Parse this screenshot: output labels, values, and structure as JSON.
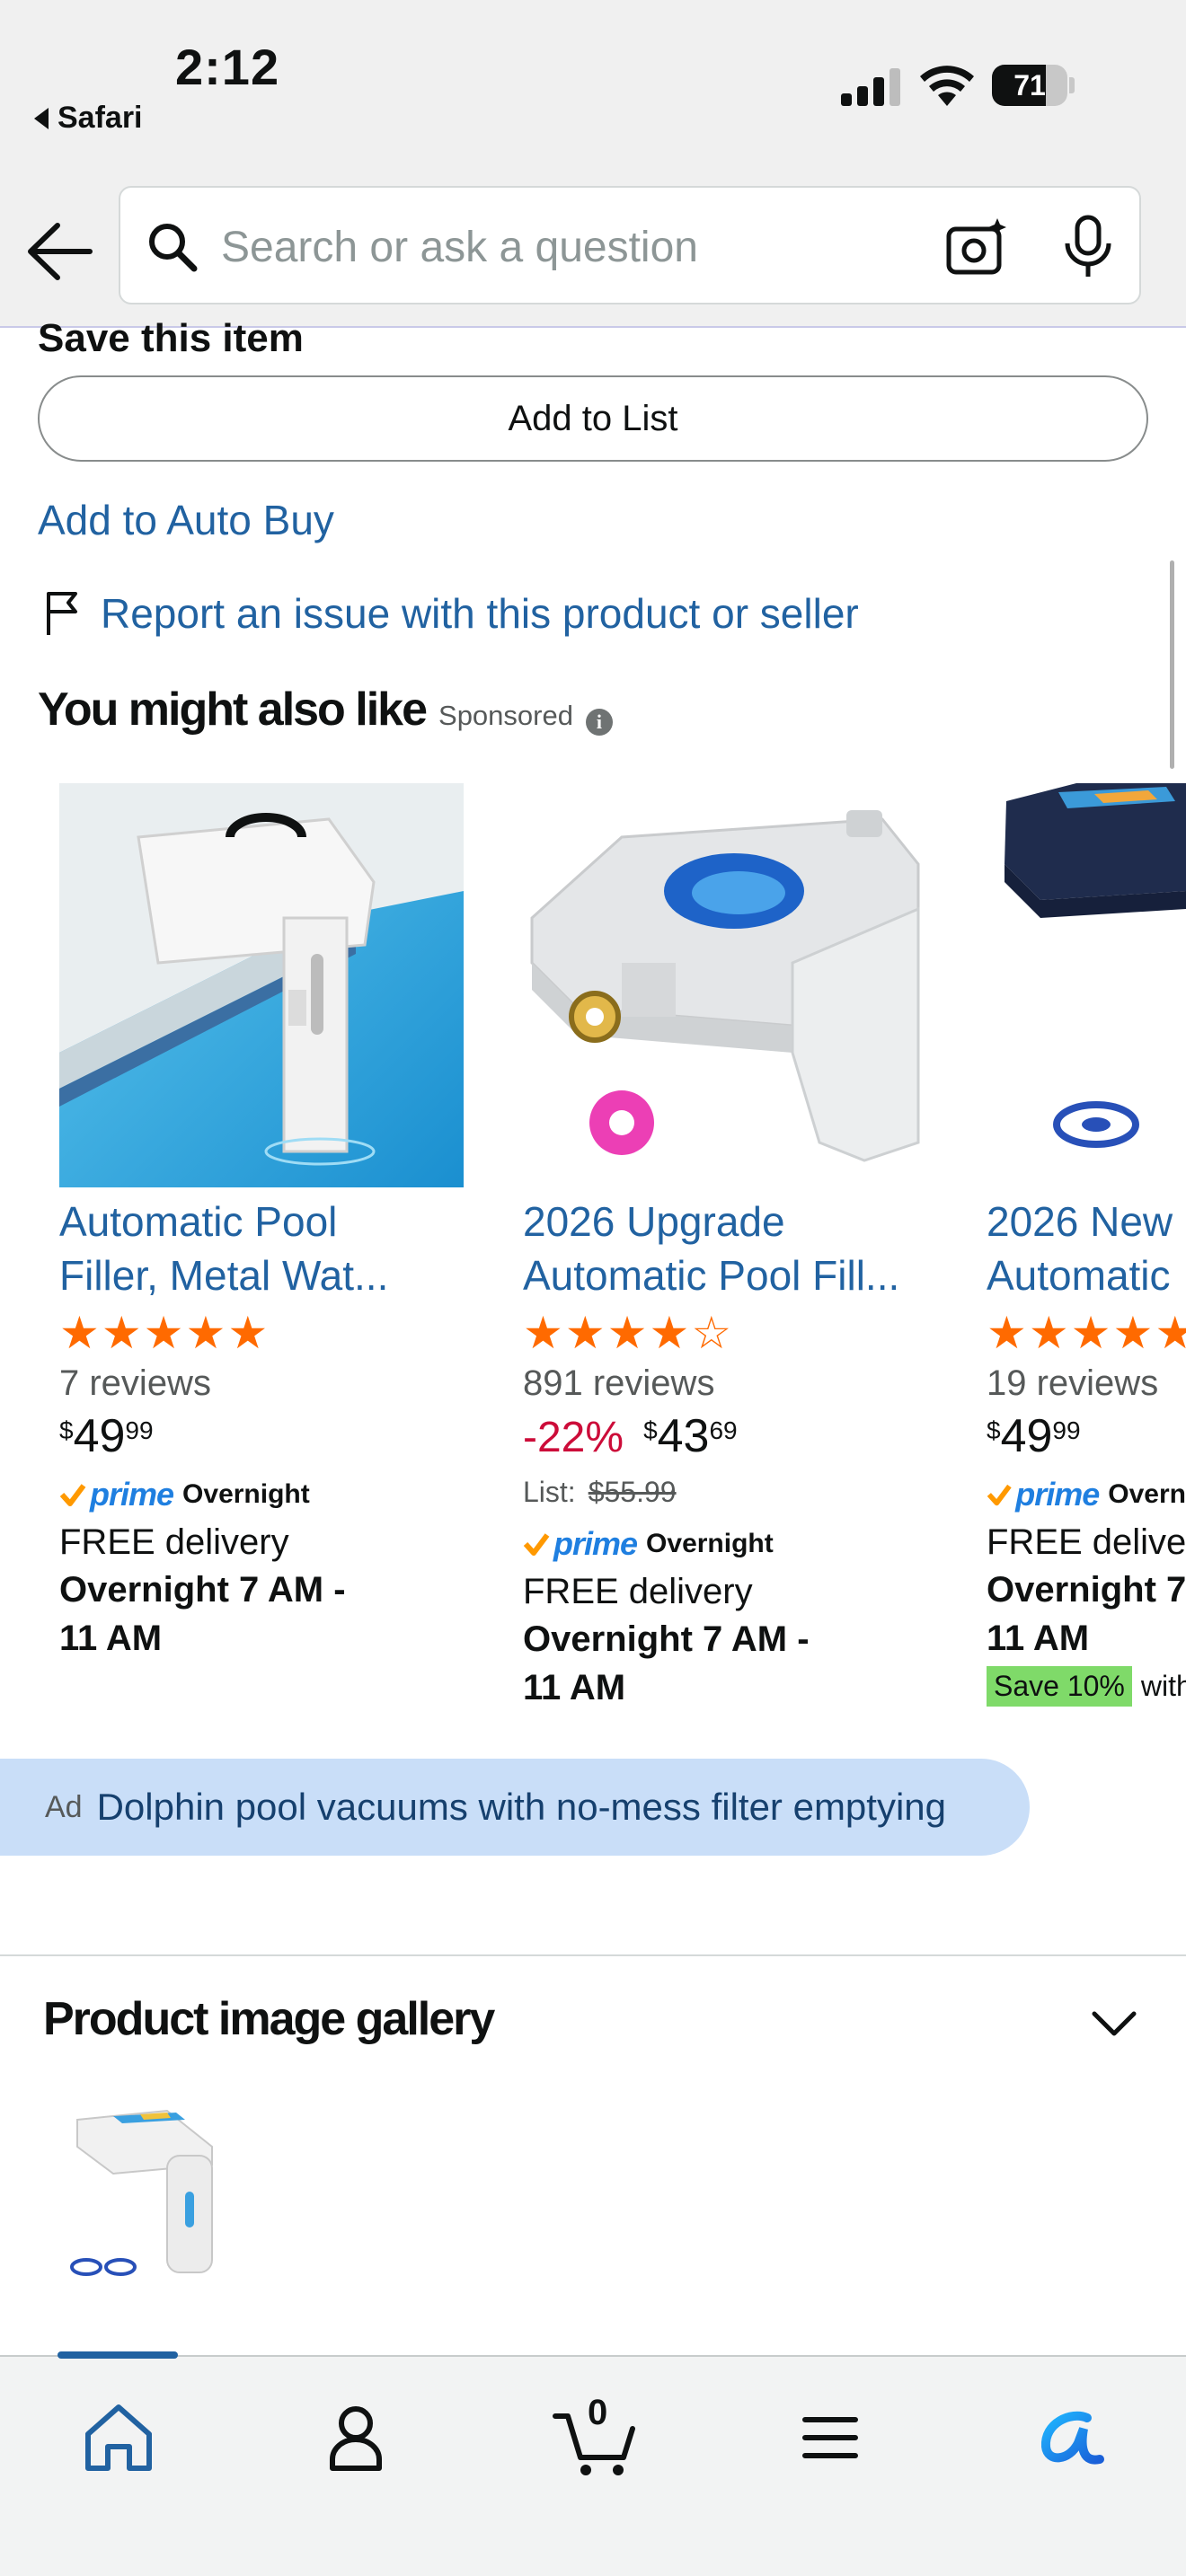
{
  "status": {
    "time": "2:12",
    "back_app": "Safari",
    "battery": "71",
    "battery_level": 0.71
  },
  "search": {
    "placeholder": "Search or ask a question"
  },
  "save": {
    "title": "Save this item",
    "add_to_list": "Add to List",
    "auto_buy": "Add to Auto Buy",
    "report": "Report an issue with this product or seller"
  },
  "recommend": {
    "title": "You might also like",
    "sponsored": "Sponsored",
    "info_glyph": "i",
    "products": [
      {
        "title_line1": "Automatic Pool",
        "title_line2": "Filler, Metal Wat...",
        "rating": 5,
        "reviews": "7 reviews",
        "price_symbol": "$",
        "price_whole": "49",
        "price_fraction": "99",
        "prime": "prime",
        "prime_speed": "Overnight",
        "delivery": "FREE delivery",
        "delivery_time_line1": "Overnight 7 AM -",
        "delivery_time_line2": "11 AM"
      },
      {
        "title_line1": "2026 Upgrade",
        "title_line2": "Automatic Pool Fill...",
        "rating": 4,
        "reviews": "891 reviews",
        "discount": "-22%",
        "price_symbol": "$",
        "price_whole": "43",
        "price_fraction": "69",
        "list_label": "List:",
        "list_price": "$55.99",
        "prime": "prime",
        "prime_speed": "Overnight",
        "delivery": "FREE delivery",
        "delivery_time_line1": "Overnight 7 AM -",
        "delivery_time_line2": "11 AM"
      },
      {
        "title_line1": "2026 New",
        "title_line2": "Automatic",
        "rating": 5,
        "reviews": "19 reviews",
        "price_symbol": "$",
        "price_whole": "49",
        "price_fraction": "99",
        "prime": "prime",
        "prime_speed": "Overn",
        "delivery": "FREE deliver",
        "delivery_time_line1": "Overnight 7",
        "delivery_time_line2": "11 AM",
        "save_badge": "Save 10%",
        "save_with": "with"
      }
    ]
  },
  "ad": {
    "label": "Ad",
    "text": "Dolphin pool vacuums with no-mess filter emptying"
  },
  "gallery": {
    "title": "Product image gallery"
  },
  "nav": {
    "cart_count": "0",
    "items": [
      "home-icon",
      "account-icon",
      "cart-icon",
      "menu-icon",
      "rufus-icon"
    ],
    "accent": "#2162a1"
  }
}
